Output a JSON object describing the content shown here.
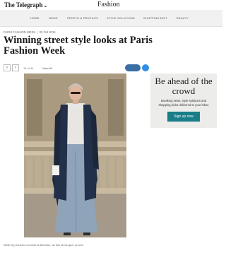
{
  "header": {
    "brand": "The Telegraph",
    "section": "Fashion"
  },
  "nav": {
    "items": [
      "HOME",
      "NEWS",
      "PEOPLE & PROFILES",
      "STYLE SOLUTIONS",
      "SHOPPING EDIT",
      "BEAUTY"
    ]
  },
  "article": {
    "kicker_section": "PARIS FASHION WEEK",
    "kicker_date": "03 Oct 2015",
    "headline": "Winning street style looks at Paris Fashion Week"
  },
  "gallery": {
    "counter": "15 of 44",
    "view_all": "View All",
    "prev_icon": "chevron-left-icon",
    "next_icon": "chevron-right-icon",
    "caption": "Wide leg trousers command attention, as this show-goer proves"
  },
  "promo": {
    "title": "Be ahead of the crowd",
    "subtitle": "Breaking news, style solutions and shopping picks delivered to your inbox",
    "button": "Sign up now",
    "button_color": "#1a7d8a"
  }
}
